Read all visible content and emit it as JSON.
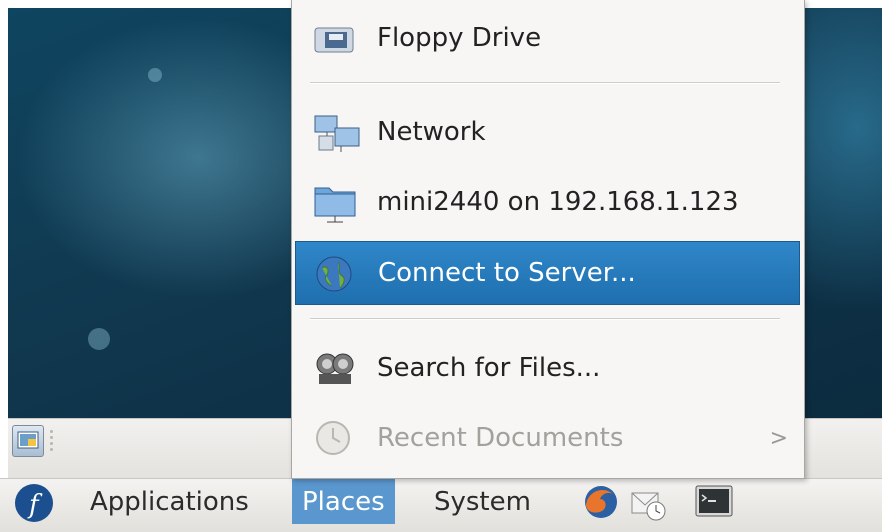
{
  "places_menu": {
    "items": [
      {
        "label": "Floppy Drive",
        "icon": "floppy-drive-icon"
      },
      {
        "label": "Network",
        "icon": "network-icon"
      },
      {
        "label": "mini2440 on 192.168.1.123",
        "icon": "network-share-folder-icon"
      },
      {
        "label": "Connect to Server...",
        "icon": "connect-server-icon",
        "state": "highlighted"
      },
      {
        "label": "Search for Files...",
        "icon": "search-files-icon"
      },
      {
        "label": "Recent Documents",
        "icon": "recent-documents-icon",
        "state": "disabled",
        "submenu_arrow": ">"
      }
    ]
  },
  "top_panel": {
    "menus": [
      {
        "label": "Applications"
      },
      {
        "label": "Places",
        "state": "open"
      },
      {
        "label": "System"
      }
    ],
    "launchers": [
      "firefox-icon",
      "evolution-mail-icon",
      "terminal-icon"
    ]
  },
  "bottom_panel": {
    "items": [
      "show-desktop-icon"
    ]
  },
  "colors": {
    "menu_highlight": "#2478bb",
    "panel_active": "#5a97cf",
    "desktop_bg": "#10384f"
  }
}
